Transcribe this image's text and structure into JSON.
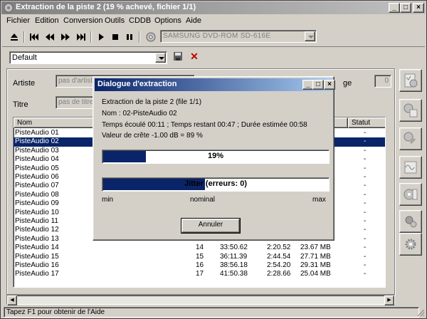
{
  "window": {
    "title": "Extraction de la piste 2 (19 % achevé, fichier 1/1)",
    "controls": [
      "_",
      "□",
      "×"
    ]
  },
  "menu": [
    "Fichier",
    "Edition",
    "Conversion",
    "Outils",
    "CDDB",
    "Options",
    "Aide"
  ],
  "toolbar": {
    "icons": [
      "eject-icon",
      "first-track-icon",
      "rewind-icon",
      "fast-forward-icon",
      "last-track-icon",
      "play-icon",
      "stop-icon",
      "pause-icon",
      "cd-icon"
    ],
    "drive": "SAMSUNG DVD-ROM SD-616E"
  },
  "profile": {
    "value": "Default"
  },
  "fields": {
    "artist_label": "Artiste",
    "artist_placeholder": "pas d'artiste",
    "title_label": "Titre",
    "title_placeholder": "pas de titre",
    "right_label": "ge",
    "right_value": "0"
  },
  "track_list": {
    "columns": [
      "Nom",
      "Statut"
    ],
    "rows": [
      {
        "name": "PisteAudio 01",
        "num": "",
        "time": "",
        "size": "",
        "mb": "",
        "status": "-",
        "selected": false
      },
      {
        "name": "PisteAudio 02",
        "num": "",
        "time": "",
        "size": "",
        "mb": "",
        "status": "-",
        "selected": true
      },
      {
        "name": "PisteAudio 03",
        "num": "",
        "time": "",
        "size": "",
        "mb": "",
        "status": "-",
        "selected": false
      },
      {
        "name": "PisteAudio 04",
        "num": "",
        "time": "",
        "size": "",
        "mb": "",
        "status": "-",
        "selected": false
      },
      {
        "name": "PisteAudio 05",
        "num": "",
        "time": "",
        "size": "",
        "mb": "",
        "status": "-",
        "selected": false
      },
      {
        "name": "PisteAudio 06",
        "num": "",
        "time": "",
        "size": "",
        "mb": "",
        "status": "-",
        "selected": false
      },
      {
        "name": "PisteAudio 07",
        "num": "",
        "time": "",
        "size": "",
        "mb": "",
        "status": "-",
        "selected": false
      },
      {
        "name": "PisteAudio 08",
        "num": "",
        "time": "",
        "size": "",
        "mb": "",
        "status": "-",
        "selected": false
      },
      {
        "name": "PisteAudio 09",
        "num": "",
        "time": "",
        "size": "",
        "mb": "",
        "status": "-",
        "selected": false
      },
      {
        "name": "PisteAudio 10",
        "num": "",
        "time": "",
        "size": "",
        "mb": "",
        "status": "-",
        "selected": false
      },
      {
        "name": "PisteAudio 11",
        "num": "",
        "time": "",
        "size": "",
        "mb": "",
        "status": "-",
        "selected": false
      },
      {
        "name": "PisteAudio 12",
        "num": "",
        "time": "",
        "size": "",
        "mb": "",
        "status": "-",
        "selected": false
      },
      {
        "name": "PisteAudio 13",
        "num": "",
        "time": "",
        "size": "",
        "mb": "",
        "status": "-",
        "selected": false
      },
      {
        "name": "PisteAudio 14",
        "num": "14",
        "time": "33:50.62",
        "size": "2:20.52",
        "mb": "23.67 MB",
        "status": "-",
        "selected": false
      },
      {
        "name": "PisteAudio 15",
        "num": "15",
        "time": "36:11.39",
        "size": "2:44.54",
        "mb": "27.71 MB",
        "status": "-",
        "selected": false
      },
      {
        "name": "PisteAudio 16",
        "num": "16",
        "time": "38:56.18",
        "size": "2:54.20",
        "mb": "29.31 MB",
        "status": "-",
        "selected": false
      },
      {
        "name": "PisteAudio 17",
        "num": "17",
        "time": "41:50.38",
        "size": "2:28.66",
        "mb": "25.04 MB",
        "status": "-",
        "selected": false
      }
    ]
  },
  "status": "Tapez F1 pour obtenir de l'Aide",
  "dialog": {
    "title": "Dialogue d'extraction",
    "line1": "Extraction de la piste 2 (file 1/1)",
    "line2": "Nom : 02-PisteAudio 02",
    "line3": "Temps écoulé 00:11 ; Temps restant 00:47 ; Durée estimée 00:58",
    "line4": "Valeur de crête -1.00 dB = 89 %",
    "progress_label": "19%",
    "progress_value": 0.19,
    "jitter_label": "Jitter (erreurs: 0)",
    "jitter_value": 0.45,
    "scale_min": "min",
    "scale_nominal": "nominal",
    "scale_max": "max",
    "cancel_label": "Annuler"
  },
  "colors": {
    "face": "#d4d0c8",
    "selection": "#0a246a",
    "active_title": "#0a246a",
    "inactive_title": "#808080"
  }
}
